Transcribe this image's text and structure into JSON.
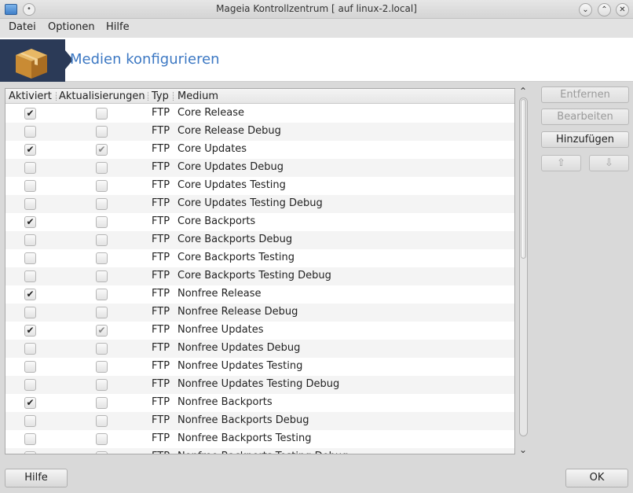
{
  "window": {
    "title": "Mageia Kontrollzentrum  [ auf linux-2.local]"
  },
  "menu": {
    "items": [
      "Datei",
      "Optionen",
      "Hilfe"
    ]
  },
  "banner": {
    "title": "Medien konfigurieren"
  },
  "table": {
    "headers": [
      "Aktiviert",
      "Aktualisierungen",
      "Typ",
      "Medium"
    ],
    "rows": [
      {
        "enabled": true,
        "updates": false,
        "type": "FTP",
        "medium": "Core Release"
      },
      {
        "enabled": false,
        "updates": false,
        "type": "FTP",
        "medium": "Core Release Debug"
      },
      {
        "enabled": true,
        "updates": true,
        "type": "FTP",
        "medium": "Core Updates"
      },
      {
        "enabled": false,
        "updates": false,
        "type": "FTP",
        "medium": "Core Updates Debug"
      },
      {
        "enabled": false,
        "updates": false,
        "type": "FTP",
        "medium": "Core Updates Testing"
      },
      {
        "enabled": false,
        "updates": false,
        "type": "FTP",
        "medium": "Core Updates Testing Debug"
      },
      {
        "enabled": true,
        "updates": false,
        "type": "FTP",
        "medium": "Core Backports"
      },
      {
        "enabled": false,
        "updates": false,
        "type": "FTP",
        "medium": "Core Backports Debug"
      },
      {
        "enabled": false,
        "updates": false,
        "type": "FTP",
        "medium": "Core Backports Testing"
      },
      {
        "enabled": false,
        "updates": false,
        "type": "FTP",
        "medium": "Core Backports Testing Debug"
      },
      {
        "enabled": true,
        "updates": false,
        "type": "FTP",
        "medium": "Nonfree Release"
      },
      {
        "enabled": false,
        "updates": false,
        "type": "FTP",
        "medium": "Nonfree Release Debug"
      },
      {
        "enabled": true,
        "updates": true,
        "type": "FTP",
        "medium": "Nonfree Updates"
      },
      {
        "enabled": false,
        "updates": false,
        "type": "FTP",
        "medium": "Nonfree Updates Debug"
      },
      {
        "enabled": false,
        "updates": false,
        "type": "FTP",
        "medium": "Nonfree Updates Testing"
      },
      {
        "enabled": false,
        "updates": false,
        "type": "FTP",
        "medium": "Nonfree Updates Testing Debug"
      },
      {
        "enabled": true,
        "updates": false,
        "type": "FTP",
        "medium": "Nonfree Backports"
      },
      {
        "enabled": false,
        "updates": false,
        "type": "FTP",
        "medium": "Nonfree Backports Debug"
      },
      {
        "enabled": false,
        "updates": false,
        "type": "FTP",
        "medium": "Nonfree Backports Testing"
      },
      {
        "enabled": false,
        "updates": false,
        "type": "FTP",
        "medium": "Nonfree Backports Testing Debug"
      }
    ]
  },
  "actions": {
    "remove": "Entfernen",
    "edit": "Bearbeiten",
    "add": "Hinzufügen",
    "up_icon": "arrow-up-icon",
    "down_icon": "arrow-down-icon"
  },
  "footer": {
    "help": "Hilfe",
    "ok": "OK"
  },
  "icons": {
    "app": "mageia-app-icon",
    "banner": "package-box-icon"
  }
}
